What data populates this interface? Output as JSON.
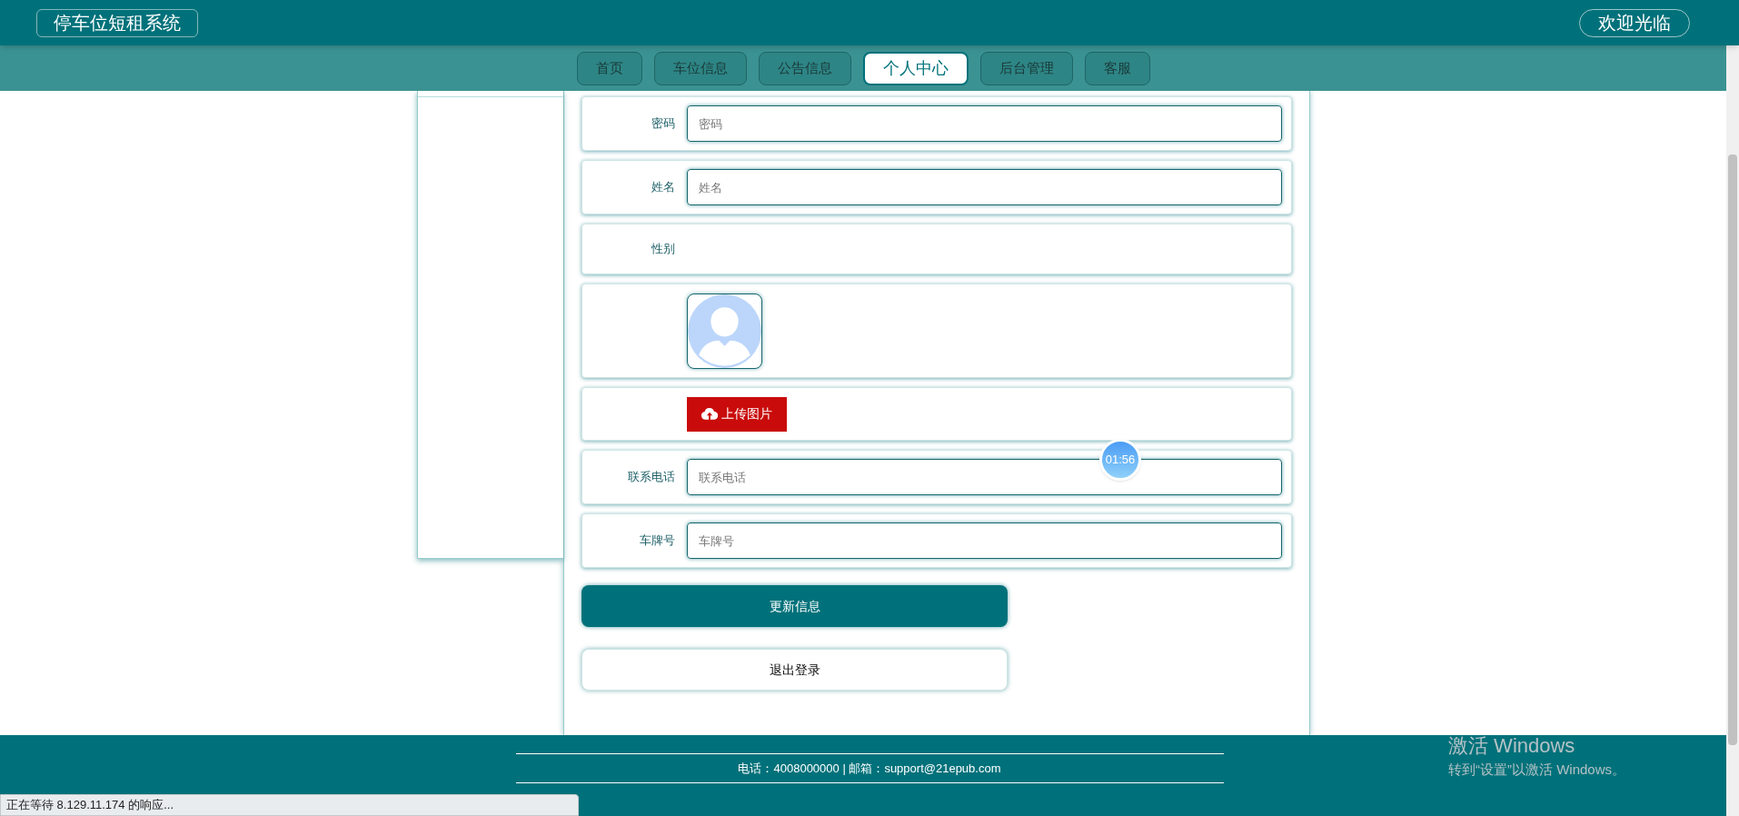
{
  "header": {
    "title": "停车位短租系统",
    "welcome": "欢迎光临"
  },
  "nav": [
    {
      "label": "首页",
      "selected": false
    },
    {
      "label": "车位信息",
      "selected": false
    },
    {
      "label": "公告信息",
      "selected": false
    },
    {
      "label": "个人中心",
      "selected": true
    },
    {
      "label": "后台管理",
      "selected": false
    },
    {
      "label": "客服",
      "selected": false
    }
  ],
  "form": {
    "rows": [
      {
        "kind": "input",
        "label": "密码",
        "placeholder": "密码"
      },
      {
        "kind": "input",
        "label": "姓名",
        "placeholder": "姓名"
      },
      {
        "kind": "text",
        "label": "性别"
      },
      {
        "kind": "avatar"
      },
      {
        "kind": "upload",
        "button": "上传图片"
      },
      {
        "kind": "input",
        "label": "联系电话",
        "placeholder": "联系电话"
      },
      {
        "kind": "input",
        "label": "车牌号",
        "placeholder": "车牌号"
      }
    ],
    "update_button": "更新信息",
    "logout_button": "退出登录"
  },
  "timer_badge": "01:56",
  "footer": {
    "contact": "电话：4008000000 | 邮箱：support@21epub.com"
  },
  "status_bar": "正在等待 8.129.11.174 的响应...",
  "activation_notice": {
    "title": "激活 Windows",
    "subtitle": "转到“设置”以激活 Windows。"
  }
}
